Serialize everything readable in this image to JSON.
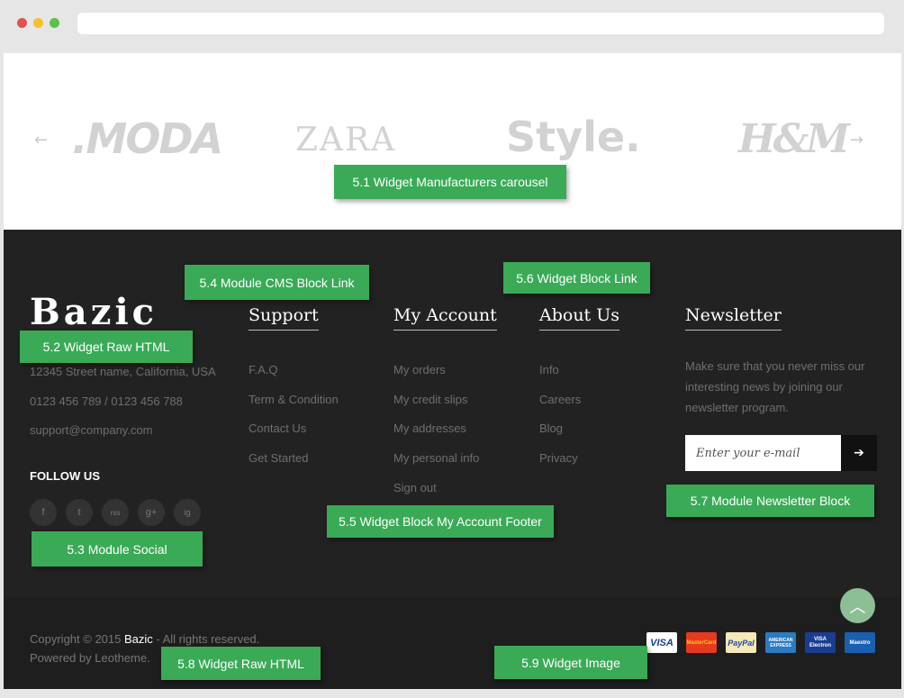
{
  "browser": {
    "dots": [
      "#e05252",
      "#f2c12e",
      "#5cbf4e"
    ]
  },
  "carousel": {
    "prev": "←",
    "next": "→",
    "brands": [
      ".MODA",
      "ZARA",
      "Style.",
      "H&M"
    ]
  },
  "labels": {
    "l51": "5.1 Widget  Manufacturers carousel",
    "l52": "5.2 Widget Raw HTML",
    "l53": "5.3 Module Social",
    "l54": "5.4 Module CMS Block Link",
    "l55": "5.5 Widget Block My Account Footer",
    "l56": "5.6 Widget Block Link",
    "l57": "5.7 Module Newsletter Block",
    "l58": "5.8 Widget Raw HTML",
    "l59": "5.9 Widget Image"
  },
  "footer": {
    "logo": "Bazic",
    "address": "12345 Street name, California, USA",
    "phone": "0123 456 789 / 0123 456 788",
    "email": "support@company.com",
    "follow": "FOLLOW US",
    "social": [
      "f",
      "t",
      "rss",
      "g+",
      "ig"
    ],
    "support": {
      "title": "Support",
      "links": [
        "F.A.Q",
        "Term & Condition",
        "Contact Us",
        "Get Started"
      ]
    },
    "account": {
      "title": "My Account",
      "links": [
        "My orders",
        "My credit slips",
        "My addresses",
        "My personal info",
        "Sign out"
      ]
    },
    "about": {
      "title": "About Us",
      "links": [
        "Info",
        "Careers",
        "Blog",
        "Privacy"
      ]
    },
    "newsletter": {
      "title": "Newsletter",
      "text": "Make sure that you never miss our interesting news by joining our newsletter program.",
      "placeholder": "Enter your e-mail",
      "button": "➔"
    }
  },
  "bottom": {
    "copyright_prefix": "Copyright © 2015 ",
    "brand": "Bazic",
    "copyright_suffix": " - All rights reserved.",
    "powered": "Powered by Leotheme.",
    "totop": "︿",
    "cards": [
      "VISA",
      "MasterCard",
      "PayPal",
      "AMERICAN EXPRESS",
      "VISA Electron",
      "Maestro"
    ]
  }
}
